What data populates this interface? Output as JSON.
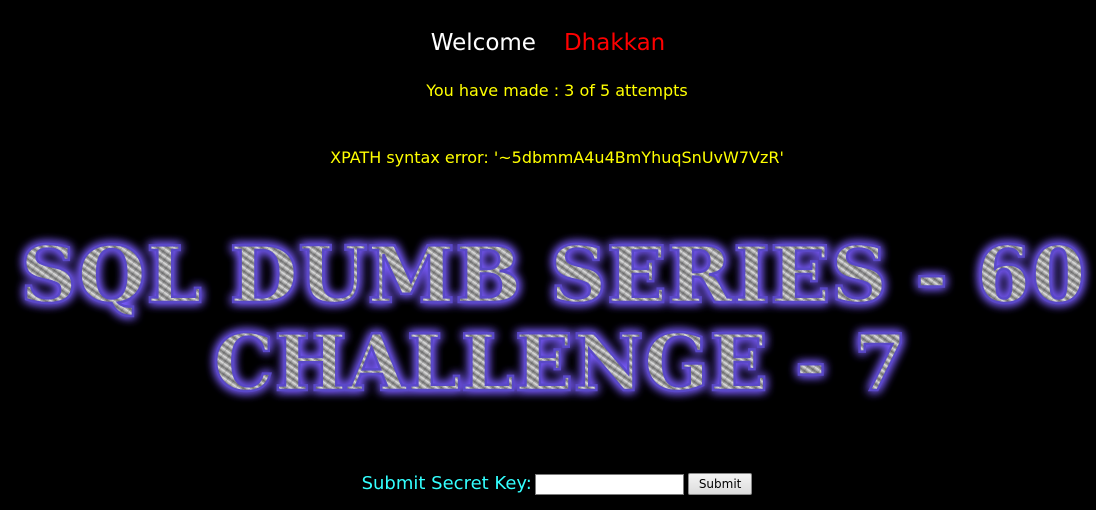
{
  "greeting": {
    "welcome": "Welcome",
    "username": "Dhakkan"
  },
  "status": {
    "attempts": "You have made : 3 of 5 attempts",
    "error": "XPATH syntax error: '~5dbmmA4u4BmYhuqSnUvW7VzR'"
  },
  "banner": {
    "line1": "SQL DUMB SERIES - 60",
    "line2": "CHALLENGE - 7"
  },
  "form": {
    "label": "Submit Secret Key:",
    "input_value": "",
    "submit_label": "Submit"
  },
  "colors": {
    "background": "#000000",
    "welcome": "#ffffff",
    "username": "#ff0000",
    "status": "#ffff00",
    "label": "#33ffff",
    "banner_glow": "#7a5cff"
  }
}
